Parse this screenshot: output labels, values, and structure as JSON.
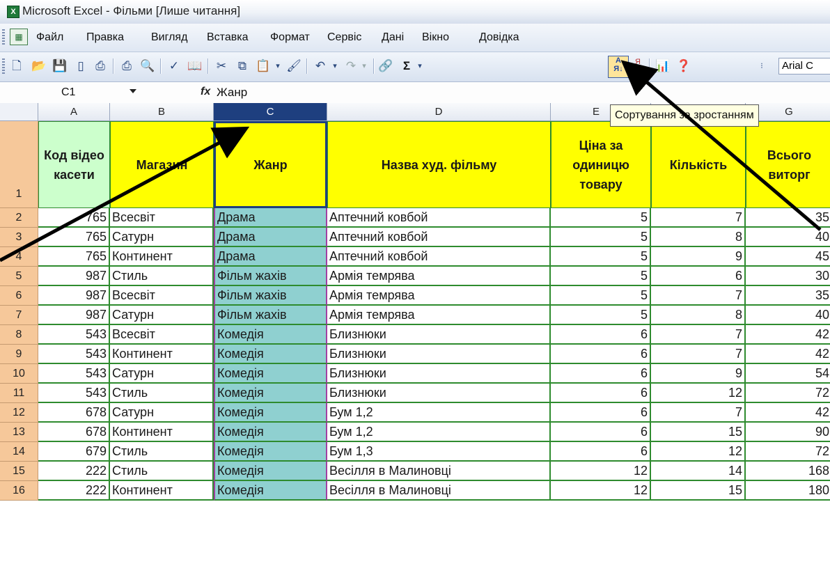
{
  "window": {
    "title": "Microsoft Excel - Фільми  [Лише читання]"
  },
  "menu": [
    "Файл",
    "Правка",
    "Вигляд",
    "Вставка",
    "Формат",
    "Сервіс",
    "Дані",
    "Вікно",
    "Довідка"
  ],
  "toolbar": {
    "icons": [
      "new-icon",
      "open-icon",
      "save-icon",
      "permission-icon",
      "print-icon",
      "print-preview-icon",
      "spelling-icon",
      "research-icon",
      "cut-icon",
      "copy-icon",
      "paste-icon",
      "format-painter-icon",
      "undo-icon",
      "redo-icon",
      "hyperlink-icon",
      "autosum-icon",
      "sort-ascending-icon",
      "sort-descending-icon",
      "chart-wizard-icon",
      "help-icon"
    ],
    "font": "Arial C",
    "sort_tooltip": "Сортування за зростанням"
  },
  "formula_bar": {
    "name_box": "C1",
    "fx": "fx",
    "formula": "Жанр"
  },
  "columns": [
    "A",
    "B",
    "C",
    "D",
    "E",
    "F",
    "G"
  ],
  "selected_column": "C",
  "header_row": {
    "row": "1",
    "A": "Код відео касети",
    "B": "Магазин",
    "C": "Жанр",
    "D": "Назва худ. фільму",
    "E": "Ціна за одиницю товару",
    "F": "Кількість",
    "G": "Всього виторг"
  },
  "rows": [
    {
      "n": "2",
      "a": "765",
      "b": "Всесвіт",
      "c": "Драма",
      "d": "Аптечний ковбой",
      "e": "5",
      "f": "7",
      "g": "35"
    },
    {
      "n": "3",
      "a": "765",
      "b": "Сатурн",
      "c": "Драма",
      "d": "Аптечний ковбой",
      "e": "5",
      "f": "8",
      "g": "40"
    },
    {
      "n": "4",
      "a": "765",
      "b": "Континент",
      "c": "Драма",
      "d": "Аптечний ковбой",
      "e": "5",
      "f": "9",
      "g": "45"
    },
    {
      "n": "5",
      "a": "987",
      "b": "Стиль",
      "c": "Фільм жахів",
      "d": "Армія темрява",
      "e": "5",
      "f": "6",
      "g": "30"
    },
    {
      "n": "6",
      "a": "987",
      "b": "Всесвіт",
      "c": "Фільм жахів",
      "d": "Армія темрява",
      "e": "5",
      "f": "7",
      "g": "35"
    },
    {
      "n": "7",
      "a": "987",
      "b": "Сатурн",
      "c": "Фільм жахів",
      "d": "Армія темрява",
      "e": "5",
      "f": "8",
      "g": "40"
    },
    {
      "n": "8",
      "a": "543",
      "b": "Всесвіт",
      "c": "Комедія",
      "d": "Близнюки",
      "e": "6",
      "f": "7",
      "g": "42"
    },
    {
      "n": "9",
      "a": "543",
      "b": "Континент",
      "c": "Комедія",
      "d": "Близнюки",
      "e": "6",
      "f": "7",
      "g": "42"
    },
    {
      "n": "10",
      "a": "543",
      "b": "Сатурн",
      "c": "Комедія",
      "d": "Близнюки",
      "e": "6",
      "f": "9",
      "g": "54"
    },
    {
      "n": "11",
      "a": "543",
      "b": "Стиль",
      "c": "Комедія",
      "d": "Близнюки",
      "e": "6",
      "f": "12",
      "g": "72"
    },
    {
      "n": "12",
      "a": "678",
      "b": "Сатурн",
      "c": "Комедія",
      "d": "Бум 1,2",
      "e": "6",
      "f": "7",
      "g": "42"
    },
    {
      "n": "13",
      "a": "678",
      "b": "Континент",
      "c": "Комедія",
      "d": "Бум 1,2",
      "e": "6",
      "f": "15",
      "g": "90"
    },
    {
      "n": "14",
      "a": "679",
      "b": "Стиль",
      "c": "Комедія",
      "d": "Бум 1,3",
      "e": "6",
      "f": "12",
      "g": "72"
    },
    {
      "n": "15",
      "a": "222",
      "b": "Стиль",
      "c": "Комедія",
      "d": "Весілля в Малиновці",
      "e": "12",
      "f": "14",
      "g": "168"
    },
    {
      "n": "16",
      "a": "222",
      "b": "Континент",
      "c": "Комедія",
      "d": "Весілля в Малиновці",
      "e": "12",
      "f": "15",
      "g": "180"
    }
  ]
}
